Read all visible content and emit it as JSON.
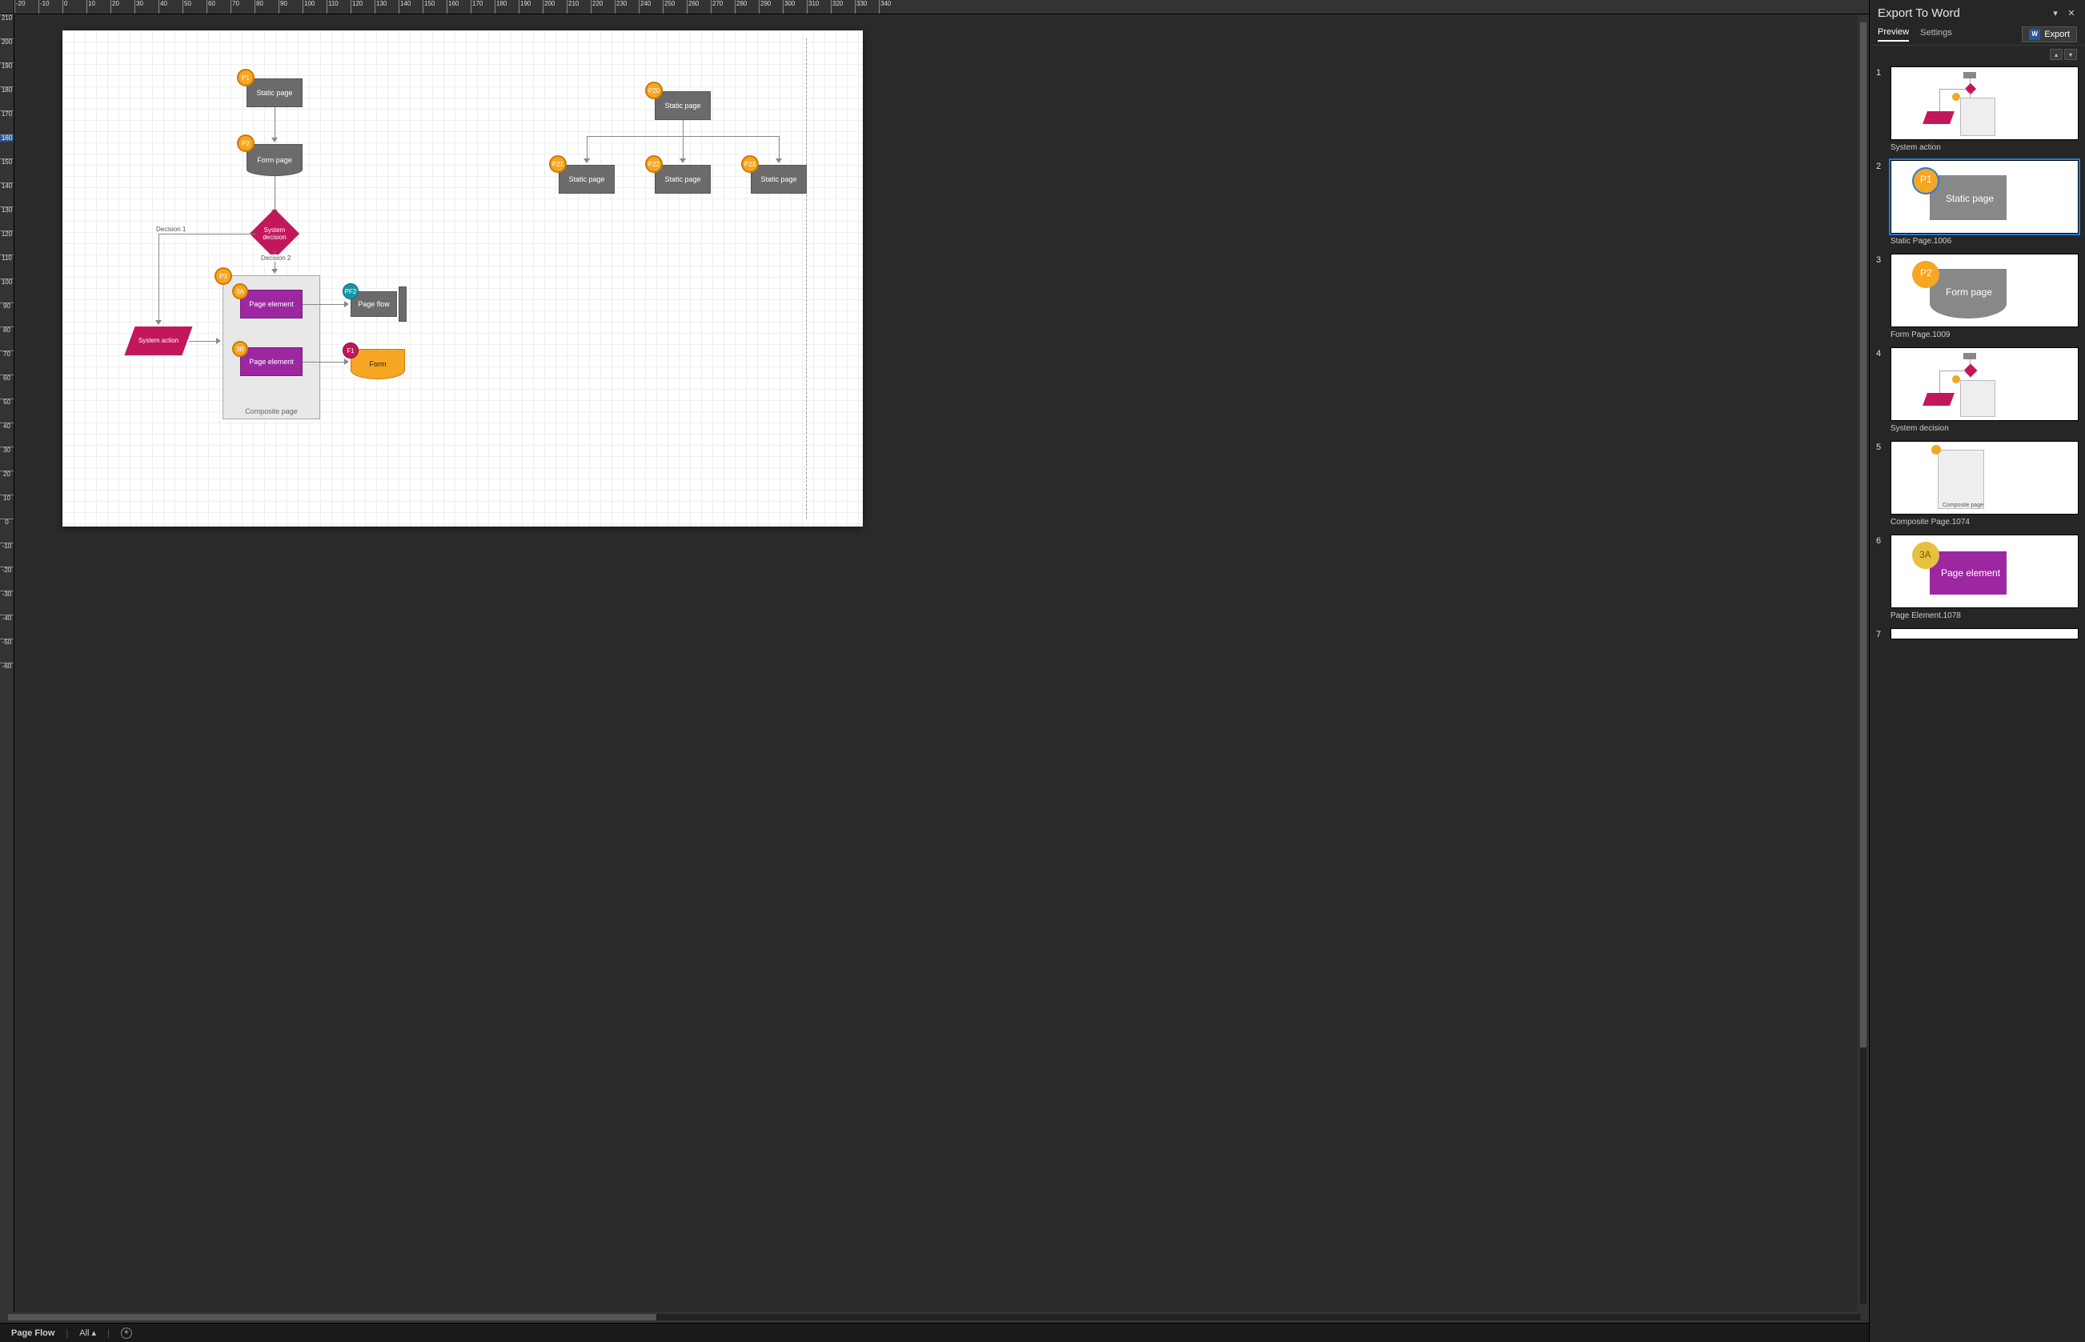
{
  "panel": {
    "title": "Export To Word",
    "tabs": {
      "preview": "Preview",
      "settings": "Settings"
    },
    "export_label": "Export",
    "word_icon": "W",
    "items": [
      {
        "num": "1",
        "caption": "System action"
      },
      {
        "num": "2",
        "caption": "Static Page.1006"
      },
      {
        "num": "3",
        "caption": "Form Page.1009"
      },
      {
        "num": "4",
        "caption": "System decision"
      },
      {
        "num": "5",
        "caption": "Composite Page.1074"
      },
      {
        "num": "6",
        "caption": "Page Element.1078"
      },
      {
        "num": "7",
        "caption": ""
      }
    ],
    "thumb_labels": {
      "p1": "P1",
      "static_page": "Static page",
      "p2": "P2",
      "form_page": "Form page",
      "p3a": "3A",
      "page_element": "Page element",
      "composite_page": "Composite page"
    }
  },
  "statusbar": {
    "page_name": "Page Flow",
    "filter": "All"
  },
  "ruler": {
    "h_start": -20,
    "h_end": 340,
    "h_step": 10,
    "v_start": 210,
    "v_end": -60,
    "v_step": -10,
    "v_highlight": 160
  },
  "canvas": {
    "badges": {
      "p1": "P1",
      "p2": "P2",
      "p3": "P3",
      "b3a": "3A",
      "b3b": "3B",
      "pf2": "PF2",
      "f1": "F1",
      "p20": "P20",
      "p21": "P21",
      "p22": "P22",
      "p23": "P23"
    },
    "shapes": {
      "static_page1": "Static page",
      "form_page": "Form page",
      "system_decision": "System decision",
      "decision1": "Decision 1",
      "decision2": "Decision 2",
      "system_action": "System\naction",
      "composite_page": "Composite page",
      "page_element_a": "Page element",
      "page_element_b": "Page element",
      "page_flow": "Page flow",
      "form": "Form",
      "static_page_top": "Static page",
      "static_page_c1": "Static page",
      "static_page_c2": "Static page",
      "static_page_c3": "Static page"
    }
  }
}
